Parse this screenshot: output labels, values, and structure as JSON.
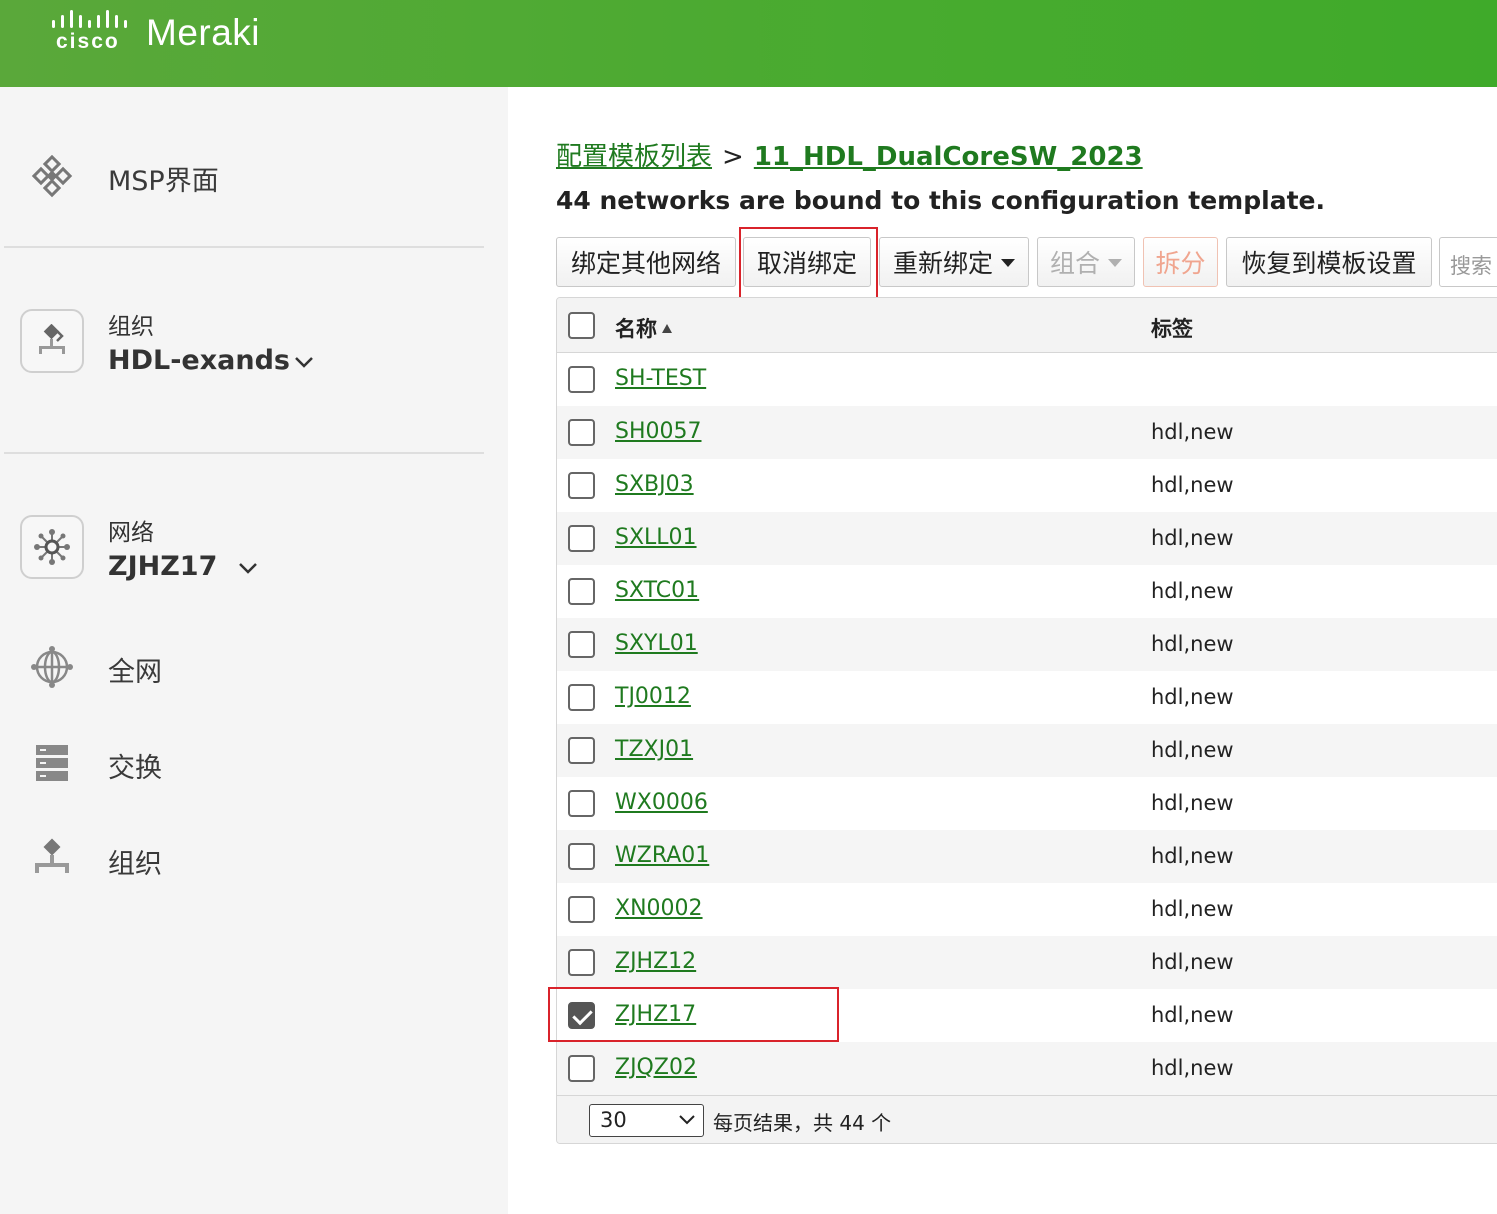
{
  "header": {
    "logo_text": "cisco",
    "brand": "Meraki",
    "color": "#48ab2f"
  },
  "sidebar": {
    "msp": {
      "label": "MSP界面",
      "icon": "msp-icon"
    },
    "org": {
      "sub": "组织",
      "name": "HDL-exands",
      "icon": "organization-icon"
    },
    "network": {
      "sub": "网络",
      "name": "ZJHZ17",
      "icon": "network-icon"
    },
    "nav": [
      {
        "label": "全网",
        "icon": "globe-icon"
      },
      {
        "label": "交换",
        "icon": "switch-icon"
      },
      {
        "label": "组织",
        "icon": "organization-icon"
      }
    ]
  },
  "breadcrumb": {
    "parent": "配置模板列表",
    "separator": ">",
    "current": "11_HDL_DualCoreSW_2023"
  },
  "subtitle": "44 networks are bound to this configuration template.",
  "toolbar": {
    "bind_other": "绑定其他网络",
    "unbind": "取消绑定",
    "rebind": "重新绑定",
    "combine": "组合",
    "split": "拆分",
    "revert": "恢复到模板设置",
    "search_placeholder": "搜索"
  },
  "table": {
    "columns": {
      "name": "名称",
      "tags": "标签"
    },
    "rows": [
      {
        "name": "SH-TEST",
        "tags": "",
        "checked": false
      },
      {
        "name": "SH0057",
        "tags": "hdl,new",
        "checked": false
      },
      {
        "name": "SXBJ03",
        "tags": "hdl,new",
        "checked": false
      },
      {
        "name": "SXLL01",
        "tags": "hdl,new",
        "checked": false
      },
      {
        "name": "SXTC01",
        "tags": "hdl,new",
        "checked": false
      },
      {
        "name": "SXYL01",
        "tags": "hdl,new",
        "checked": false
      },
      {
        "name": "TJ0012",
        "tags": "hdl,new",
        "checked": false
      },
      {
        "name": "TZXJ01",
        "tags": "hdl,new",
        "checked": false
      },
      {
        "name": "WX0006",
        "tags": "hdl,new",
        "checked": false
      },
      {
        "name": "WZRA01",
        "tags": "hdl,new",
        "checked": false
      },
      {
        "name": "XN0002",
        "tags": "hdl,new",
        "checked": false
      },
      {
        "name": "ZJHZ12",
        "tags": "hdl,new",
        "checked": false
      },
      {
        "name": "ZJHZ17",
        "tags": "hdl,new",
        "checked": true
      },
      {
        "name": "ZJQZ02",
        "tags": "hdl,new",
        "checked": false
      }
    ],
    "footer": {
      "per_page": "30",
      "summary": "每页结果，共 44 个"
    }
  },
  "highlight_color": "#d9232b"
}
